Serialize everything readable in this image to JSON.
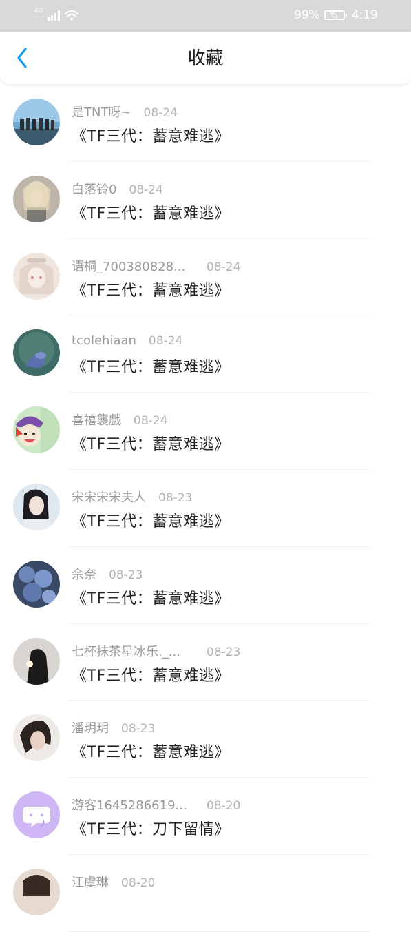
{
  "status_bar": {
    "network": "4G",
    "battery_percent": "99%",
    "time": "4:19"
  },
  "header": {
    "back_icon": "chevron-left-icon",
    "title": "收藏"
  },
  "colors": {
    "accent": "#1a9be8",
    "status_bar_bg": "#d9d9d9"
  },
  "items": [
    {
      "name": "是TNT呀~",
      "date": "08-24",
      "book": "《TF三代：蓄意难逃》",
      "avatar": "group-photo"
    },
    {
      "name": "白落铃0",
      "date": "08-24",
      "book": "《TF三代：蓄意难逃》",
      "avatar": "anime-girl"
    },
    {
      "name": "语桐_700380828...",
      "date": "08-24",
      "book": "《TF三代：蓄意难逃》",
      "avatar": "anime-girl-light"
    },
    {
      "name": "tcolehiaan",
      "date": "08-24",
      "book": "《TF三代：蓄意难逃》",
      "avatar": "peacock"
    },
    {
      "name": "喜禧襲戲",
      "date": "08-24",
      "book": "《TF三代：蓄意难逃》",
      "avatar": "cartoon-character"
    },
    {
      "name": "宋宋宋宋夫人",
      "date": "08-23",
      "book": "《TF三代：蓄意难逃》",
      "avatar": "portrait-woman"
    },
    {
      "name": "佘奈",
      "date": "08-23",
      "book": "《TF三代：蓄意难逃》",
      "avatar": "blue-roses"
    },
    {
      "name": "七杯抹茶星冰乐._...",
      "date": "08-23",
      "book": "《TF三代：蓄意难逃》",
      "avatar": "silhouette"
    },
    {
      "name": "潘玥玥",
      "date": "08-23",
      "book": "《TF三代：蓄意难逃》",
      "avatar": "portrait-man"
    },
    {
      "name": "游客1645286619...",
      "date": "08-20",
      "book": "《TF三代：刀下留情》",
      "avatar": "default-chat"
    },
    {
      "name": "江虞琳",
      "date": "08-20",
      "book": "",
      "avatar": "portrait-partial"
    }
  ]
}
